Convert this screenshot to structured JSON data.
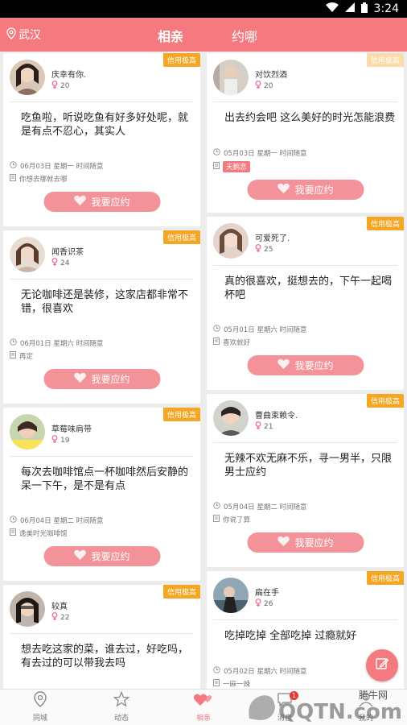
{
  "status_bar": {
    "time": "3:24"
  },
  "header": {
    "location": "武汉",
    "tabs": [
      "相亲",
      "约哪"
    ]
  },
  "badge_text": "信用极高",
  "button_label": "我要应约",
  "cards_left": [
    {
      "name": "庆幸有你.",
      "age": "20",
      "content": "吃鱼啦，听说吃鱼有好多好处呢，就是有点不忍心，其实人",
      "date": "06月03日 星期一 时间随意",
      "place": "你想去哪就去哪"
    },
    {
      "name": "闻香识茶",
      "age": "24",
      "content": "无论咖啡还是装修，这家店都非常不错，很喜欢",
      "date": "06月01日 星期六 时间随意",
      "place": "再定"
    },
    {
      "name": "草莓味肩带",
      "age": "19",
      "content": "每次去咖啡馆点一杯咖啡然后安静的呆一下午，是不是有点",
      "date": "06月04日 星期二 时间随意",
      "place": "逸美时光咖啡馆"
    },
    {
      "name": "较真",
      "age": "22",
      "content": "想去吃这家的菜，谁去过，好吃吗，有去过的可以带我去吗",
      "date": "",
      "place": ""
    }
  ],
  "cards_right": [
    {
      "name": "对饮烈酒",
      "age": "20",
      "content": "出去约会吧 这么美好的时光怎能浪费",
      "date": "05月03日 星期一 时间随意",
      "place": "天鹅恋"
    },
    {
      "name": "可爱死了.",
      "age": "25",
      "content": "真的很喜欢，挺想去的，下午一起喝杯吧",
      "date": "05月01日 星期六 时间随意",
      "place": "喜欢就好"
    },
    {
      "name": "曹曲束赖令.",
      "age": "21",
      "content": "无辣不欢无麻不乐，寻一男半，只限男士应约",
      "date": "05月04日 星期二 时间随意",
      "place": "你说了算"
    },
    {
      "name": "扁在手",
      "age": "26",
      "content": "吃掉吃掉 全部吃掉 过瘾就好",
      "date": "05月02日 星期六 时间随意",
      "place": "一麻一辣"
    }
  ],
  "tabbar": [
    "同城",
    "动态",
    "相亲",
    "消息",
    "我的"
  ],
  "message_count": "1",
  "watermark": "腾牛网"
}
